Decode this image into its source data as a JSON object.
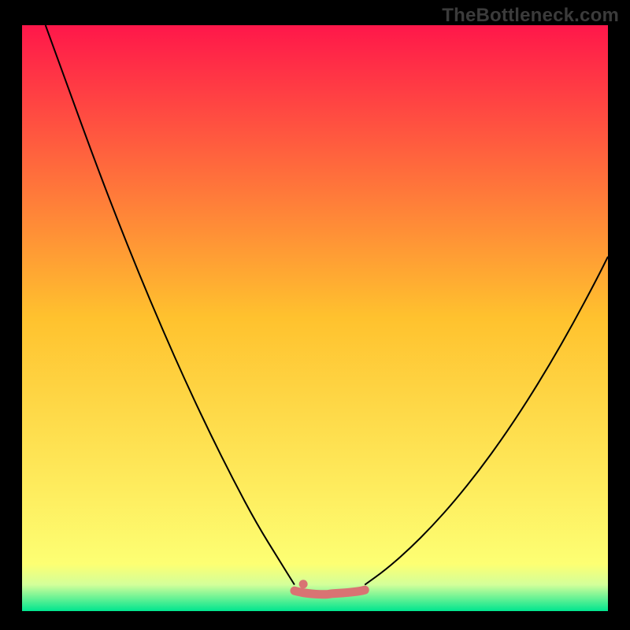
{
  "watermark": "TheBottleneck.com",
  "colors": {
    "frame_background": "#000000",
    "curve_stroke": "#000000",
    "flat_marker": "#d97373",
    "gradient_stops": [
      {
        "offset": 0.0,
        "color": "#ff174a"
      },
      {
        "offset": 0.5,
        "color": "#ffc22e"
      },
      {
        "offset": 0.92,
        "color": "#fdff73"
      },
      {
        "offset": 0.955,
        "color": "#d3ff9a"
      },
      {
        "offset": 1.0,
        "color": "#00e58f"
      }
    ]
  },
  "chart_data": {
    "type": "line",
    "title": "",
    "xlabel": "",
    "ylabel": "",
    "xlim": [
      0,
      100
    ],
    "ylim": [
      0,
      100
    ],
    "series": [
      {
        "name": "left_branch",
        "x": [
          4,
          8,
          12,
          16,
          20,
          24,
          28,
          32,
          36,
          40,
          44,
          46.5
        ],
        "y": [
          100,
          89,
          78,
          67.5,
          57.5,
          48,
          39,
          30.5,
          22.5,
          15,
          8.5,
          4.5
        ]
      },
      {
        "name": "right_branch",
        "x": [
          58.5,
          62,
          66,
          70,
          74,
          78,
          82,
          86,
          90,
          94,
          98,
          100
        ],
        "y": [
          4.5,
          7,
          10.5,
          14.5,
          19,
          24,
          29.5,
          35.5,
          42,
          49,
          56.5,
          60.5
        ]
      }
    ],
    "optimal_zone": {
      "x_start": 46.5,
      "x_end": 58.5,
      "y": 3.2,
      "bump_x": 48,
      "bump_y": 4.6
    }
  },
  "style": {
    "curve_stroke_width": 2.0,
    "flat_stroke_width": 11,
    "flat_dot_radius": 5.5
  }
}
